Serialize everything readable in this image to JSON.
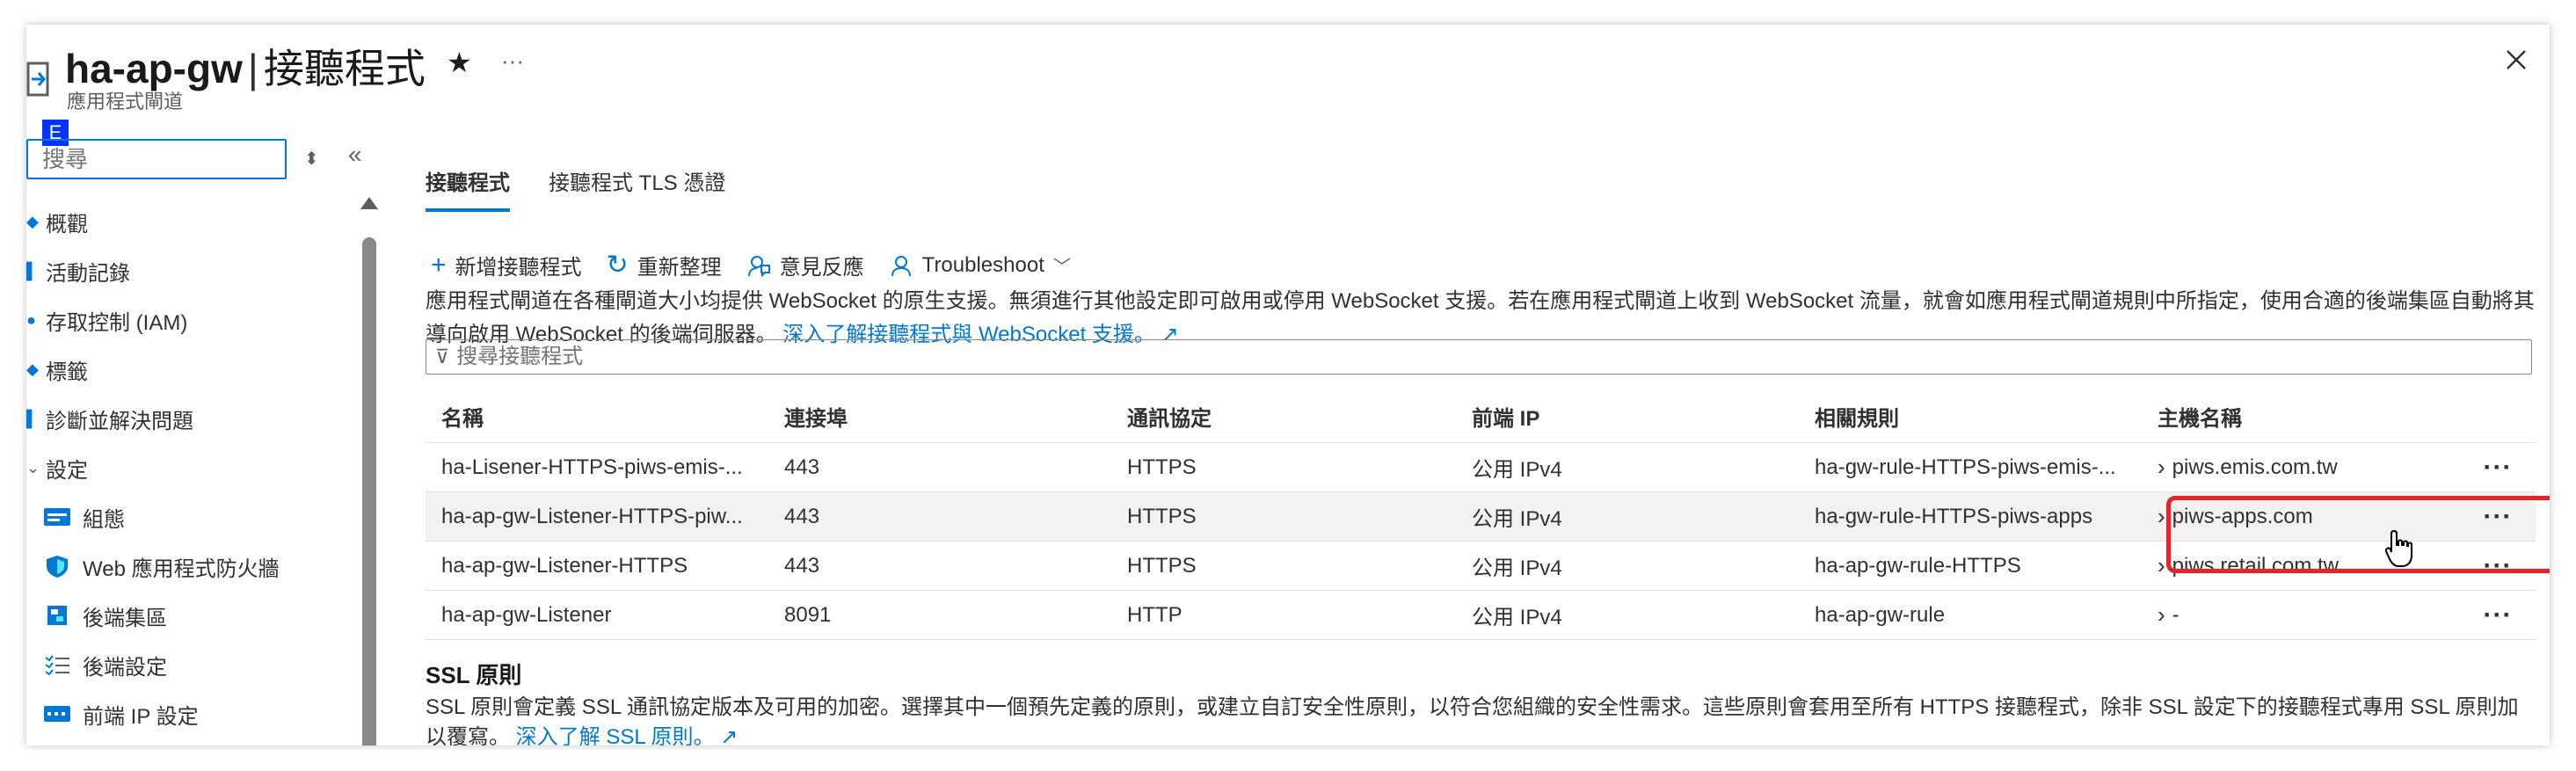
{
  "header": {
    "title": "ha-ap-gw",
    "title_separator": "|",
    "title_page": "接聽程式",
    "subtitle": "應用程式閘道",
    "favorite_icon": "star-icon",
    "more_label": "···",
    "close_icon": "close-icon"
  },
  "sidebar": {
    "badge": "E",
    "search_placeholder": "搜尋",
    "items": [
      {
        "label": "概觀",
        "icon": "overview-icon"
      },
      {
        "label": "活動記錄",
        "icon": "activity-log-icon"
      },
      {
        "label": "存取控制 (IAM)",
        "icon": "iam-icon"
      },
      {
        "label": "標籤",
        "icon": "tag-icon"
      },
      {
        "label": "診斷並解決問題",
        "icon": "diagnose-icon"
      },
      {
        "label": "設定",
        "icon": "settings-section-icon"
      },
      {
        "label": "組態",
        "icon": "configuration-icon"
      },
      {
        "label": "Web 應用程式防火牆",
        "icon": "waf-shield-icon"
      },
      {
        "label": "後端集區",
        "icon": "backend-pool-icon"
      },
      {
        "label": "後端設定",
        "icon": "backend-settings-icon"
      },
      {
        "label": "前端 IP 設定",
        "icon": "frontend-ip-icon"
      }
    ]
  },
  "tabs": [
    {
      "label": "接聽程式",
      "active": true
    },
    {
      "label": "接聽程式 TLS 憑證",
      "active": false
    }
  ],
  "toolbar": {
    "add_label": "新增接聽程式",
    "refresh_label": "重新整理",
    "feedback_label": "意見反應",
    "troubleshoot_label": "Troubleshoot"
  },
  "info": {
    "text": "應用程式閘道在各種閘道大小均提供 WebSocket 的原生支援。無須進行其他設定即可啟用或停用 WebSocket 支援。若在應用程式閘道上收到 WebSocket 流量，就會如應用程式閘道規則中所指定，使用合適的後端集區自動將其導向啟用 WebSocket 的後端伺服器。",
    "link": "深入了解接聽程式與 WebSocket 支援。"
  },
  "filter": {
    "placeholder": "搜尋接聽程式"
  },
  "grid": {
    "columns": [
      "名稱",
      "連接埠",
      "通訊協定",
      "前端 IP",
      "相關規則",
      "主機名稱"
    ],
    "rows": [
      {
        "name": "ha-Lisener-HTTPS-piws-emis-...",
        "port": "443",
        "protocol": "HTTPS",
        "frontend_ip": "公用 IPv4",
        "rule": "ha-gw-rule-HTTPS-piws-emis-...",
        "host": "piws.emis.com.tw",
        "more": "···"
      },
      {
        "name": "ha-ap-gw-Listener-HTTPS-piw...",
        "port": "443",
        "protocol": "HTTPS",
        "frontend_ip": "公用 IPv4",
        "rule": "ha-gw-rule-HTTPS-piws-apps",
        "host": "piws-apps.com",
        "more": "···"
      },
      {
        "name": "ha-ap-gw-Listener-HTTPS",
        "port": "443",
        "protocol": "HTTPS",
        "frontend_ip": "公用 IPv4",
        "rule": "ha-ap-gw-rule-HTTPS",
        "host": "piws.retail.com.tw",
        "more": "···"
      },
      {
        "name": "ha-ap-gw-Listener",
        "port": "8091",
        "protocol": "HTTP",
        "frontend_ip": "公用 IPv4",
        "rule": "ha-ap-gw-rule",
        "host": "-",
        "more": "···"
      }
    ]
  },
  "ssl": {
    "title": "SSL 原則",
    "text": "SSL 原則會定義 SSL 通訊協定版本及可用的加密。選擇其中一個預先定義的原則，或建立自訂安全性原則，以符合您組織的安全性需求。這些原則會套用至所有 HTTPS 接聽程式，除非 SSL 設定下的接聽程式專用 SSL 原則加以覆寫。",
    "link": "深入了解 SSL 原則。"
  },
  "colors": {
    "accent": "#0078d4",
    "highlight": "#e3242b"
  }
}
